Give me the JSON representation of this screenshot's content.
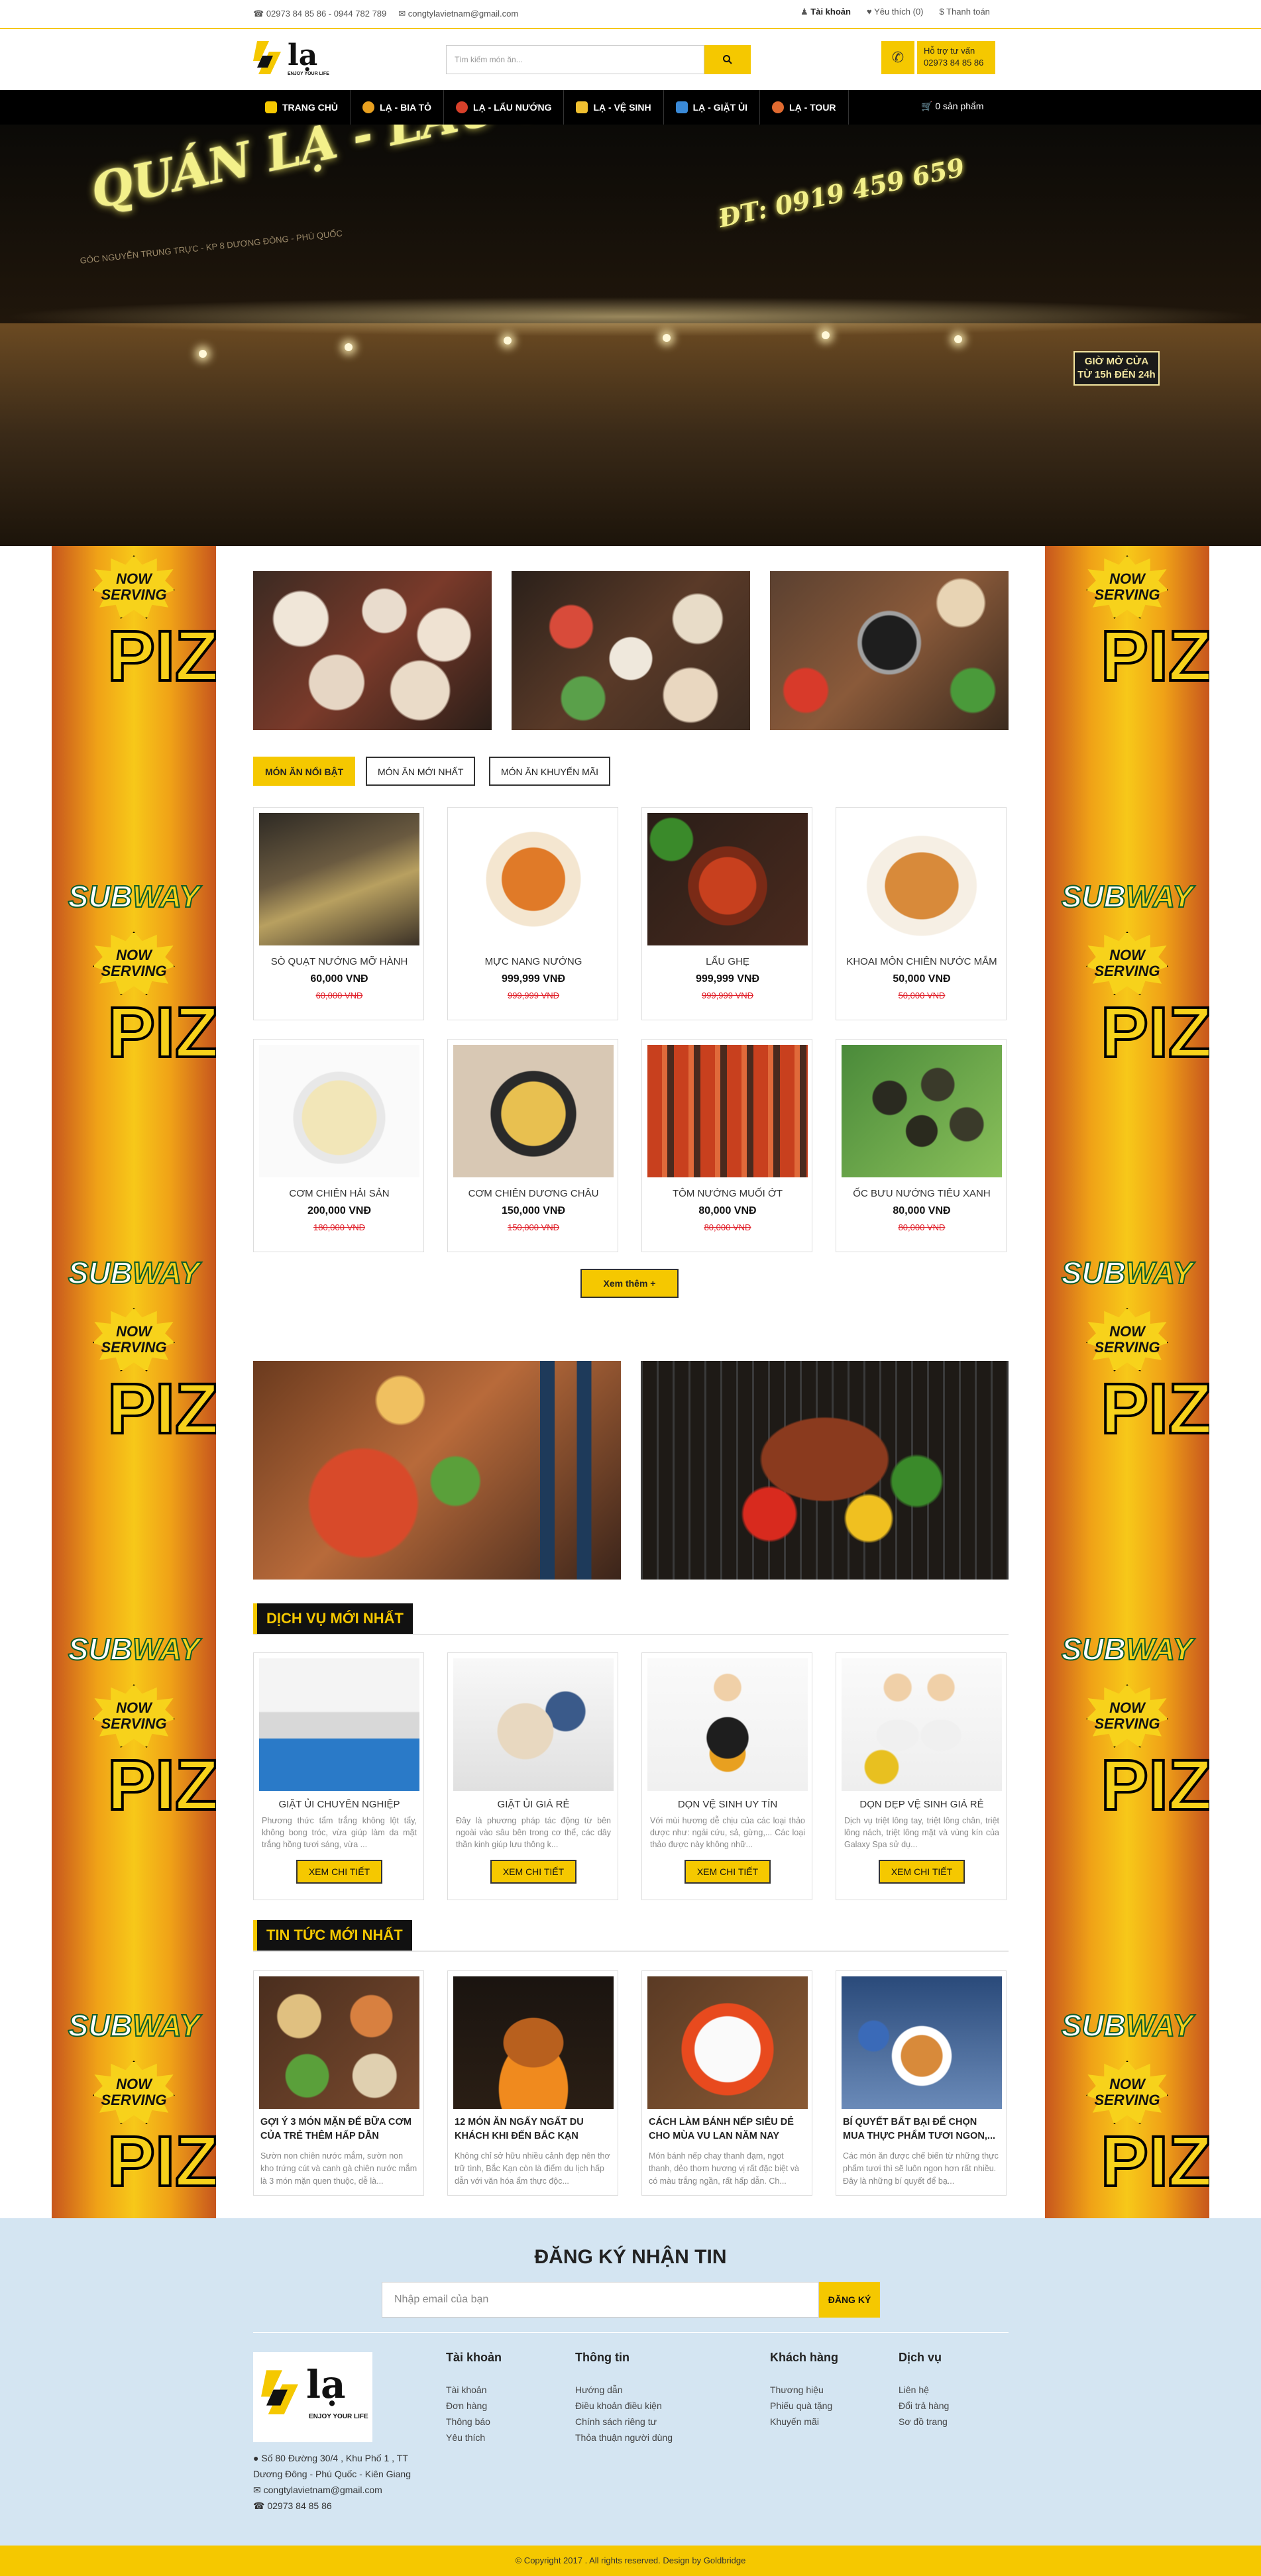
{
  "topbar": {
    "phones": "02973 84 85 86 - 0944 782 789",
    "email": "congtylavietnam@gmail.com",
    "account": "Tài khoản",
    "wishlist": "Yêu thích (0)",
    "checkout": "Thanh toán"
  },
  "header": {
    "logo_text": "lạ",
    "logo_tagline": "ENJOY YOUR LIFE",
    "search_placeholder": "Tìm kiếm món ăn...",
    "support_label": "Hỗ trợ tư vấn",
    "support_phone": "02973 84 85 86"
  },
  "nav": {
    "items": [
      {
        "label": "TRANG CHỦ",
        "icon": "home-icon",
        "color": "#f5c800"
      },
      {
        "label": "LẠ - BIA TỎ",
        "icon": "beer-icon",
        "color": "#e8a020"
      },
      {
        "label": "LẠ - LẨU NƯỚNG",
        "icon": "hotpot-icon",
        "color": "#d8402a"
      },
      {
        "label": "LẠ - VỆ SINH",
        "icon": "cleaning-icon",
        "color": "#f0c030"
      },
      {
        "label": "LẠ - GIẶT ỦI",
        "icon": "laundry-icon",
        "color": "#3a8ad8"
      },
      {
        "label": "LẠ - TOUR",
        "icon": "tour-icon",
        "color": "#e06a30"
      }
    ],
    "cart": "0 sản phẩm"
  },
  "hero": {
    "sign_text": "QUÁN LẠ - LẨU & NƯỚNG",
    "sign_phone": "ĐT: 0919 459 659",
    "sign_address": "GÓC NGUYỄN TRUNG TRỰC - KP 8 DƯƠNG ĐÔNG - PHÚ QUỐC",
    "sign_hours": "GIỜ MỞ CỬA TỪ 15h ĐẾN 24h"
  },
  "side_ad": {
    "badge": "NOW SERVING",
    "word": "PIZZ",
    "brand_a": "SUB",
    "brand_b": "WAY"
  },
  "tabs": [
    {
      "label": "MÓN ĂN NỔI BẬT",
      "active": true
    },
    {
      "label": "MÓN ĂN MỚI NHẤT",
      "active": false
    },
    {
      "label": "MÓN ĂN KHUYẾN MÃI",
      "active": false
    }
  ],
  "products": [
    {
      "name": "SÒ QUẠT NƯỚNG MỠ HÀNH",
      "price": "60,000 VNĐ",
      "old": "60,000 VNĐ"
    },
    {
      "name": "MỰC NANG NƯỚNG",
      "price": "999,999 VNĐ",
      "old": "999,999 VNĐ"
    },
    {
      "name": "LẨU GHẸ",
      "price": "999,999 VNĐ",
      "old": "999,999 VNĐ"
    },
    {
      "name": "KHOAI MÔN CHIÊN NƯỚC MẮM",
      "price": "50,000 VNĐ",
      "old": "50,000 VNĐ"
    },
    {
      "name": "CƠM CHIÊN HẢI SẢN",
      "price": "200,000 VNĐ",
      "old": "180,000 VNĐ"
    },
    {
      "name": "CƠM CHIÊN DƯƠNG CHÂU",
      "price": "150,000 VNĐ",
      "old": "150,000 VNĐ"
    },
    {
      "name": "TÔM NƯỚNG MUỐI ỚT",
      "price": "80,000 VNĐ",
      "old": "80,000 VNĐ"
    },
    {
      "name": "ỐC BƯU NƯỚNG TIÊU XANH",
      "price": "80,000 VNĐ",
      "old": "80,000 VNĐ"
    }
  ],
  "more_button": "Xem thêm +",
  "services_title": "DỊCH VỤ MỚI NHẤT",
  "services": [
    {
      "title": "GIẶT ỦI CHUYÊN NGHIỆP",
      "desc": "Phương thức tẩm trắng không lột tẩy, không bong tróc, vừa giúp làm da mặt trắng hồng tươi sáng, vừa ..."
    },
    {
      "title": "GIẶT ỦI GIÁ RẺ",
      "desc": "Đây là phương pháp tác động từ bên ngoài vào sâu bên trong cơ thể, các dây thần kinh giúp lưu thông k..."
    },
    {
      "title": "DỌN VỆ SINH UY TÍN",
      "desc": "Với mùi hương dễ chịu của các loại thảo dược như: ngải cứu, sả, gừng,... Các loại thảo được này không nhữ..."
    },
    {
      "title": "DỌN DẸP VỆ SINH GIÁ RẺ",
      "desc": "Dịch vụ triệt lông tay, triệt lông chân, triệt lông nách, triệt lông mặt và vùng kín của Galaxy Spa sử dụ..."
    }
  ],
  "service_button": "XEM CHI TIẾT",
  "news_title": "TIN TỨC MỚI NHẤT",
  "news": [
    {
      "title": "GỢI Ý 3 MÓN MẶN ĐỂ BỮA CƠM CỦA TRẺ THÊM HẤP DẪN",
      "desc": "Sườn non chiên nước mắm, sườn non kho trứng cút và canh gà chiên nước mắm là 3 món mặn quen thuộc, dễ là..."
    },
    {
      "title": "12 MÓN ĂN NGẤY NGẤT DU KHÁCH KHI ĐẾN BẮC KẠN",
      "desc": "Không chỉ sở hữu nhiều cảnh đẹp nên thơ trữ tình, Bắc Kạn còn là điểm du lịch hấp dẫn với văn hóa ẩm thực độc..."
    },
    {
      "title": "CÁCH LÀM BÁNH NẾP SIÊU DẺ CHO MÙA VU LAN NĂM NAY",
      "desc": "Món bánh nếp chay thanh đạm, ngọt thanh, dẻo thơm hương vị rất đặc biệt và có màu trắng ngần, rất hấp dẫn. Ch..."
    },
    {
      "title": "BÍ QUYẾT BẤT BẠI ĐỂ CHỌN MUA THỰC PHẨM TƯƠI NGON,...",
      "desc": "Các món ăn được chế biến từ những thực phẩm tươi thì sẽ luôn ngon hơn rất nhiều. Đây là những bí quyết để bạ..."
    }
  ],
  "newsletter": {
    "title": "ĐĂNG KÝ NHẬN TIN",
    "placeholder": "Nhập email của bạn",
    "button": "ĐĂNG KÝ"
  },
  "footer": {
    "address": [
      "Số 80 Đường 30/4 , Khu Phố 1 , TT Dương Đông - Phú Quốc - Kiên Giang",
      "congtylavietnam@gmail.com",
      "02973 84 85 86"
    ],
    "columns": [
      {
        "title": "Tài khoản",
        "links": [
          "Tài khoản",
          "Đơn hàng",
          "Thông báo",
          "Yêu thích"
        ]
      },
      {
        "title": "Thông tin",
        "links": [
          "Hướng dẫn",
          "Điều khoản điều kiện",
          "Chính sách riêng tư",
          "Thỏa thuận người dùng"
        ]
      },
      {
        "title": "Khách hàng",
        "links": [
          "Thương hiệu",
          "Phiếu quà tặng",
          "Khuyến mãi"
        ]
      },
      {
        "title": "Dịch vụ",
        "links": [
          "Liên hệ",
          "Đổi trả hàng",
          "Sơ đồ trang"
        ]
      }
    ],
    "copyright": "© Copyright 2017 . All rights reserved. Design by Goldbridge"
  }
}
